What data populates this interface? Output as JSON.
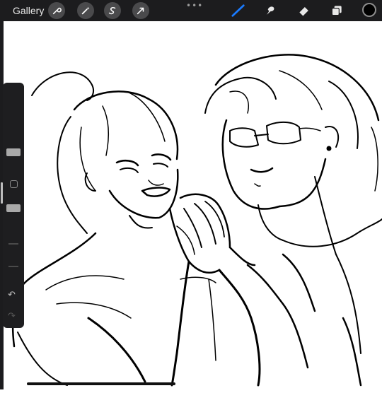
{
  "app": {
    "gallery_label": "Gallery"
  },
  "topbar": {
    "left_tools": [
      "wrench-icon",
      "magic-wand-icon",
      "selection-s-icon",
      "transform-arrow-icon"
    ],
    "right_tools": [
      "brush-icon",
      "smudge-icon",
      "eraser-icon",
      "layers-icon"
    ],
    "more_label": "•••",
    "active_tool": "brush",
    "current_color": "#000000",
    "accent": "#1a7bff"
  },
  "sidebar": {
    "undo_label": "↶",
    "redo_label": "↷",
    "brush_size_level": 0.3,
    "brush_opacity_level": 0.6
  },
  "canvas": {
    "content": "sketch-drawing"
  }
}
